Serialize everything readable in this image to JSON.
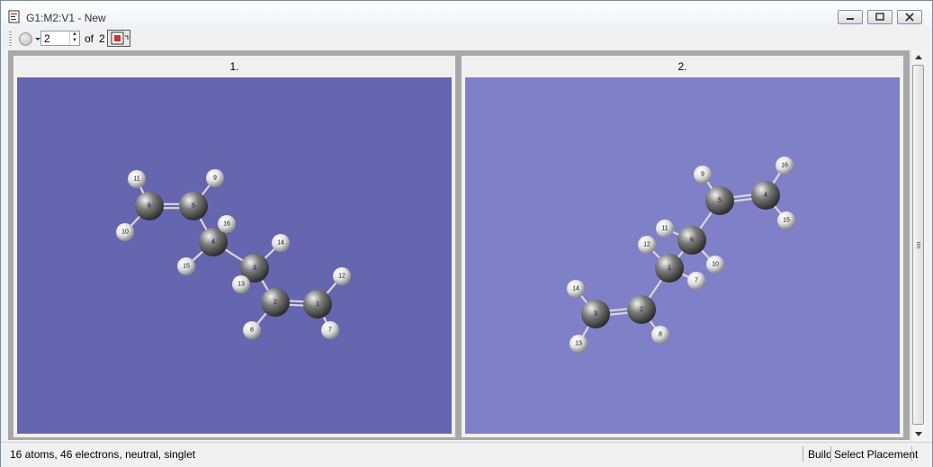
{
  "window": {
    "title": "G1:M2:V1 - New",
    "controls": {
      "minimize": "minimize-icon",
      "restore": "restore-icon",
      "close": "close-icon"
    }
  },
  "toolbar": {
    "molecule_index": "2",
    "of_label": "of",
    "total": "2"
  },
  "panels": [
    {
      "label": "1.",
      "bg": "#6565b0",
      "atoms": [
        {
          "n": "1",
          "el": "C"
        },
        {
          "n": "2",
          "el": "C"
        },
        {
          "n": "3",
          "el": "C"
        },
        {
          "n": "4",
          "el": "C"
        },
        {
          "n": "5",
          "el": "C"
        },
        {
          "n": "6",
          "el": "C"
        },
        {
          "n": "7",
          "el": "H"
        },
        {
          "n": "8",
          "el": "H"
        },
        {
          "n": "9",
          "el": "H"
        },
        {
          "n": "10",
          "el": "H"
        },
        {
          "n": "11",
          "el": "H"
        },
        {
          "n": "12",
          "el": "H"
        },
        {
          "n": "13",
          "el": "H"
        },
        {
          "n": "14",
          "el": "H"
        },
        {
          "n": "15",
          "el": "H"
        },
        {
          "n": "16",
          "el": "H"
        }
      ]
    },
    {
      "label": "2.",
      "bg": "#8080c8",
      "atoms": [
        {
          "n": "1",
          "el": "C"
        },
        {
          "n": "2",
          "el": "C"
        },
        {
          "n": "3",
          "el": "C"
        },
        {
          "n": "4",
          "el": "C"
        },
        {
          "n": "5",
          "el": "C"
        },
        {
          "n": "6",
          "el": "C"
        },
        {
          "n": "7",
          "el": "H"
        },
        {
          "n": "8",
          "el": "H"
        },
        {
          "n": "9",
          "el": "H"
        },
        {
          "n": "10",
          "el": "H"
        },
        {
          "n": "11",
          "el": "H"
        },
        {
          "n": "12",
          "el": "H"
        },
        {
          "n": "13",
          "el": "H"
        },
        {
          "n": "14",
          "el": "H"
        },
        {
          "n": "15",
          "el": "H"
        },
        {
          "n": "16",
          "el": "H"
        }
      ]
    }
  ],
  "status": {
    "summary": "16 atoms, 46 electrons, neutral, singlet",
    "mode": "Build",
    "placement": "Select Placement"
  },
  "colors": {
    "carbon": "#7a7a7a",
    "hydrogen": "#e0e0e0",
    "bond": "#d8d8d8"
  }
}
